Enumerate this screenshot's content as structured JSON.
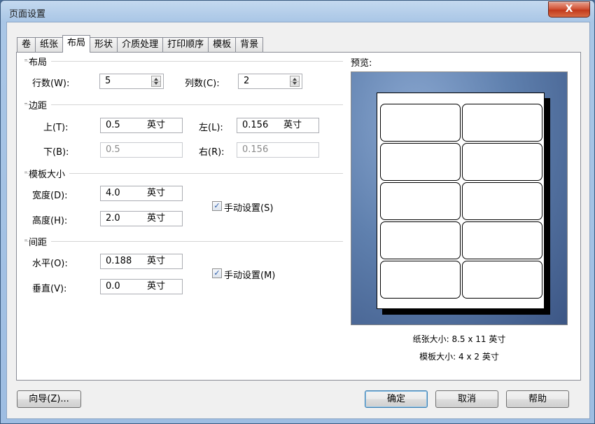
{
  "window": {
    "title": "页面设置",
    "close_label": "X"
  },
  "tabs": [
    {
      "label": "卷"
    },
    {
      "label": "纸张"
    },
    {
      "label": "布局",
      "active": true
    },
    {
      "label": "形状"
    },
    {
      "label": "介质处理"
    },
    {
      "label": "打印顺序"
    },
    {
      "label": "模板"
    },
    {
      "label": "背景"
    }
  ],
  "layout": {
    "group_label": "布局",
    "rows_label": "行数(W):",
    "rows_value": "5",
    "cols_label": "列数(C):",
    "cols_value": "2"
  },
  "margins": {
    "group_label": "边距",
    "top_label": "上(T):",
    "top_value": "0.5",
    "top_unit": "英寸",
    "left_label": "左(L):",
    "left_value": "0.156",
    "left_unit": "英寸",
    "bottom_label": "下(B):",
    "bottom_value": "0.5",
    "right_label": "右(R):",
    "right_value": "0.156"
  },
  "template_size": {
    "group_label": "模板大小",
    "width_label": "宽度(D):",
    "width_value": "4.0",
    "width_unit": "英寸",
    "height_label": "高度(H):",
    "height_value": "2.0",
    "height_unit": "英寸",
    "manual_label": "手动设置(S)",
    "manual_checked": true
  },
  "spacing": {
    "group_label": "间距",
    "horizontal_label": "水平(O):",
    "horizontal_value": "0.188",
    "horizontal_unit": "英寸",
    "vertical_label": "垂直(V):",
    "vertical_value": "0.0",
    "vertical_unit": "英寸",
    "manual_label": "手动设置(M)",
    "manual_checked": true
  },
  "preview": {
    "label": "预览:",
    "paper_size": "纸张大小: 8.5 x 11 英寸",
    "template_size": "模板大小: 4 x 2 英寸",
    "rows": 5,
    "cols": 2
  },
  "buttons": {
    "wizard": "向导(Z)...",
    "ok": "确定",
    "cancel": "取消",
    "help": "帮助"
  },
  "colors": {
    "accent": "#3c7fb1",
    "preview_bg": "#5f80ae"
  }
}
